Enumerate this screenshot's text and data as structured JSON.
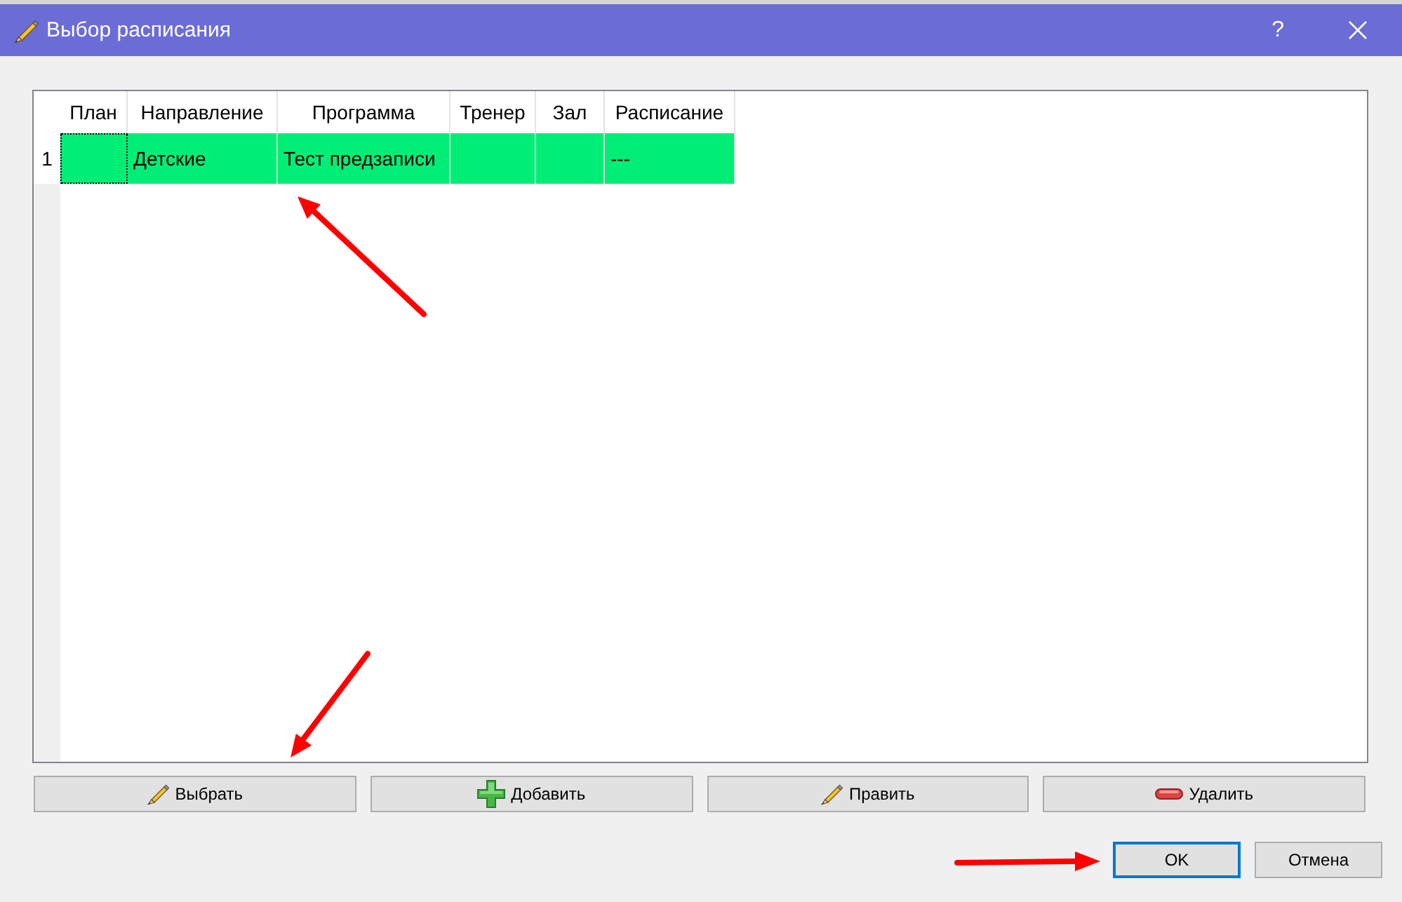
{
  "window": {
    "title": "Выбор расписания",
    "help_button": "?"
  },
  "table": {
    "columns": [
      "План",
      "Направление",
      "Программа",
      "Тренер",
      "Зал",
      "Расписание"
    ],
    "rows": [
      {
        "number": "1",
        "color": "#00ee76",
        "cells": [
          {
            "focused": true
          },
          {
            "text": "Детские",
            "focused": false
          },
          {
            "text": "Тест предзаписи",
            "focused": false
          },
          {
            "focused": false
          },
          {
            "focused": false
          },
          {
            "text": "---",
            "focused": false
          }
        ]
      }
    ]
  },
  "action_buttons": [
    {
      "kind": "select",
      "label": "Выбрать"
    },
    {
      "kind": "add",
      "label": "Добавить"
    },
    {
      "kind": "edit",
      "label": "Править"
    },
    {
      "kind": "remove",
      "label": "Удалить"
    }
  ],
  "dialog_buttons": [
    {
      "label": "OK",
      "default": true
    },
    {
      "label": "Отмена",
      "default": false
    }
  ]
}
